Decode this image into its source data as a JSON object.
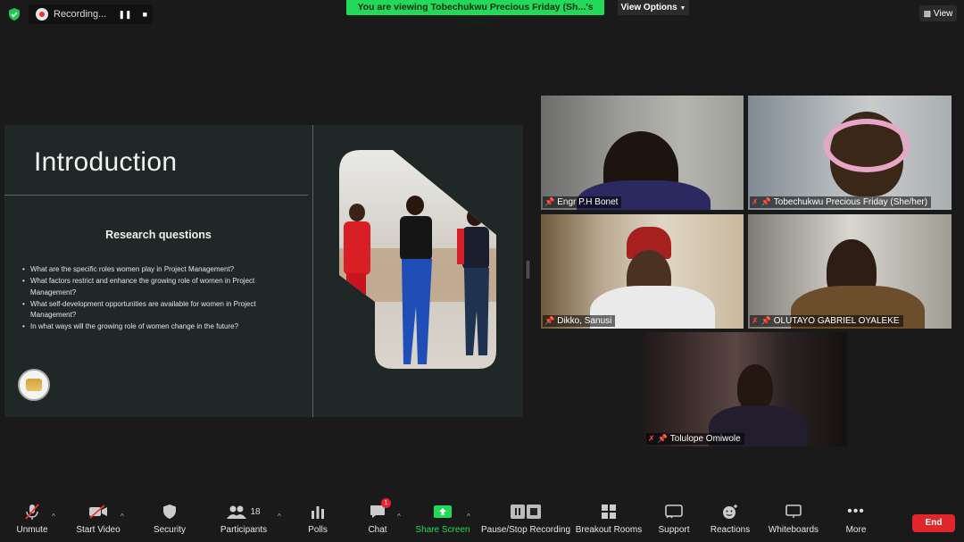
{
  "top_bar": {
    "recording_label": "Recording...",
    "viewing_banner": "You are viewing Tobechukwu Precious Friday (Sh...'s screen",
    "view_options_label": "View Options",
    "view_label": "View"
  },
  "slide": {
    "title": "Introduction",
    "rq_heading": "Research questions",
    "questions": [
      "What are the specific roles women play in Project Management?",
      "What factors restrict and enhance the growing role of women in Project Management?",
      "What self-development opportunities are available for women in Project Management?",
      "In what ways will the growing role of women change in the future?"
    ]
  },
  "participants": [
    {
      "name": "Engr P.H Bonet",
      "muted": false
    },
    {
      "name": "Tobechukwu Precious Friday (She/her)",
      "muted": true
    },
    {
      "name": "Dikko, Sanusi",
      "muted": false
    },
    {
      "name": "OLUTAYO GABRIEL OYALEKE",
      "muted": true
    },
    {
      "name": "Tolulope Omiwole",
      "muted": true
    }
  ],
  "toolbar": {
    "unmute": "Unmute",
    "start_video": "Start Video",
    "security": "Security",
    "participants": "Participants",
    "participants_count": "18",
    "polls": "Polls",
    "chat": "Chat",
    "chat_badge": "1",
    "share_screen": "Share Screen",
    "pause_stop": "Pause/Stop Recording",
    "breakout": "Breakout Rooms",
    "support": "Support",
    "reactions": "Reactions",
    "whiteboards": "Whiteboards",
    "more": "More",
    "end": "End"
  },
  "colors": {
    "share_green": "#23d959",
    "end_red": "#e0262b",
    "slide_bg": "#1f2727"
  }
}
